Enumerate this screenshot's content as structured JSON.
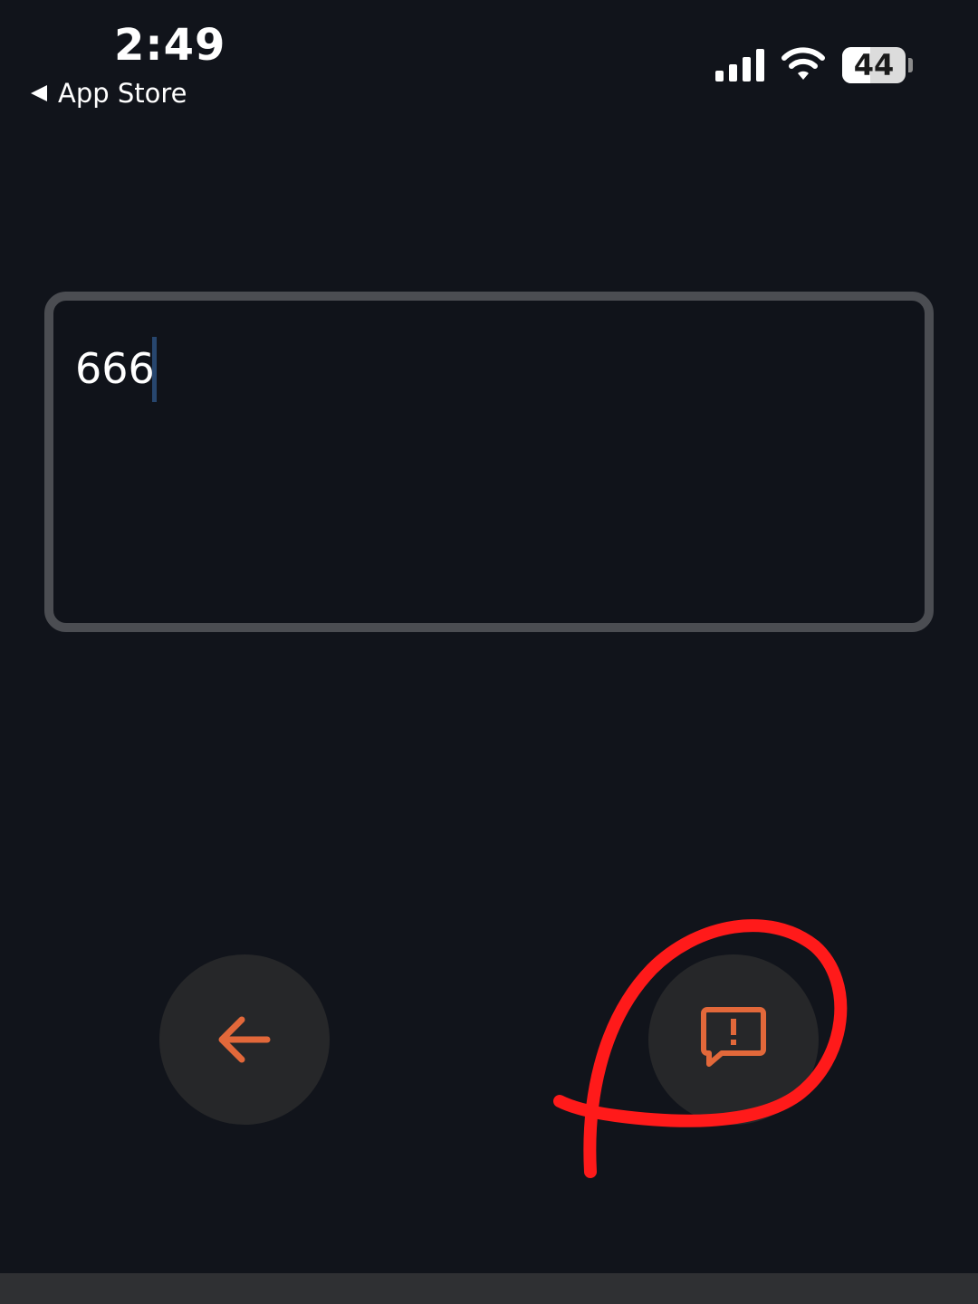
{
  "status_bar": {
    "time": "2:49",
    "back_label": "App Store",
    "battery_level": "44",
    "battery_fraction": 0.44
  },
  "input": {
    "value": "666"
  },
  "buttons": {
    "back_icon": "arrow-left-icon",
    "report_icon": "report-feedback-icon"
  },
  "colors": {
    "background": "#11141b",
    "icon_accent": "#e2683a",
    "annotation": "#ff1a1a"
  }
}
